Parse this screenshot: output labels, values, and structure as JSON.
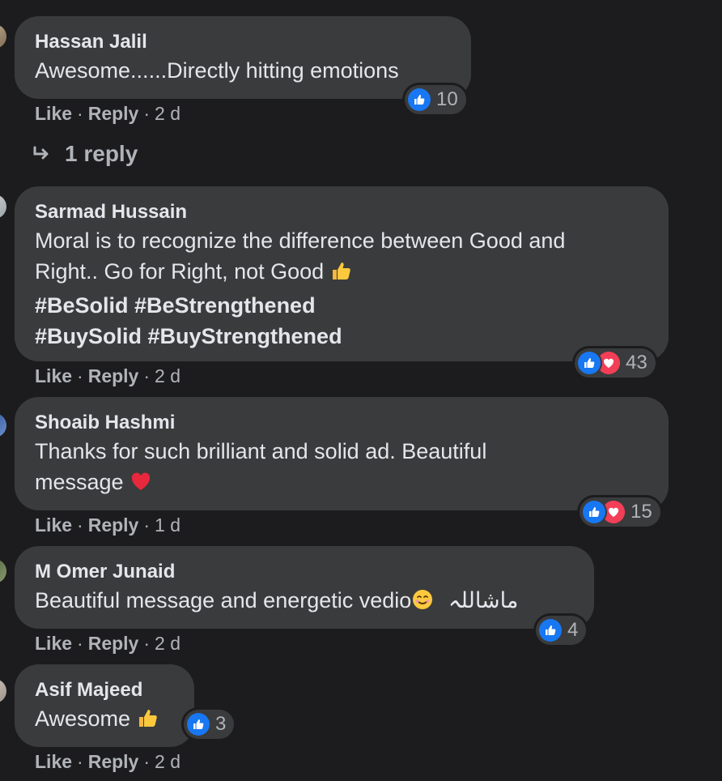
{
  "comments": [
    {
      "author": "Hassan Jalil",
      "text": "Awesome......Directly hitting emotions",
      "reaction_count": "10",
      "reactions": [
        "like"
      ],
      "like_label": "Like",
      "reply_label": "Reply",
      "time": "2 d",
      "replies_link": "1 reply"
    },
    {
      "author": "Sarmad Hussain",
      "text_line1": "Moral is to recognize the difference between Good and",
      "text_line2": "Right.. Go for Right, not Good",
      "hashtags_line1": "#BeSolid #BeStrengthened",
      "hashtags_line2": "#BuySolid #BuyStrengthened",
      "reaction_count": "43",
      "reactions": [
        "like",
        "love"
      ],
      "like_label": "Like",
      "reply_label": "Reply",
      "time": "2 d"
    },
    {
      "author": "Shoaib Hashmi",
      "text_line1": "Thanks for such brilliant and solid ad. Beautiful",
      "text_line2": "message",
      "reaction_count": "15",
      "reactions": [
        "like",
        "love"
      ],
      "like_label": "Like",
      "reply_label": "Reply",
      "time": "1 d"
    },
    {
      "author": "M Omer Junaid",
      "text": "Beautiful message and energetic vedio",
      "text_arabic": "ماشاللہ",
      "reaction_count": "4",
      "reactions": [
        "like"
      ],
      "like_label": "Like",
      "reply_label": "Reply",
      "time": "2 d"
    },
    {
      "author": "Asif Majeed",
      "text": "Awesome",
      "reaction_count": "3",
      "reactions": [
        "like"
      ],
      "like_label": "Like",
      "reply_label": "Reply",
      "time": "2 d"
    }
  ],
  "colors": {
    "background": "#1c1c1e",
    "bubble": "#3a3b3c",
    "like_blue": "#1877f2",
    "love_red": "#f33e58",
    "secondary_text": "#b0b3b8"
  }
}
